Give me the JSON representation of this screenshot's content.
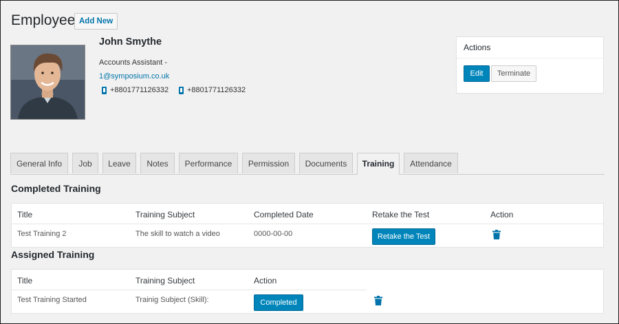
{
  "header": {
    "title": "Employee",
    "add_new_label": "Add New"
  },
  "employee": {
    "name": "John Smythe",
    "role": "Accounts Assistant -",
    "email": "1@symposium.co.uk",
    "phones": [
      "+8801771126332",
      "+8801771126332"
    ]
  },
  "actions": {
    "title": "Actions",
    "edit_label": "Edit",
    "terminate_label": "Terminate"
  },
  "tabs": [
    "General Info",
    "Job",
    "Leave",
    "Notes",
    "Performance",
    "Permission",
    "Documents",
    "Training",
    "Attendance"
  ],
  "active_tab": "Training",
  "completed_training": {
    "heading": "Completed Training",
    "columns": [
      "Title",
      "Training Subject",
      "Completed Date",
      "Retake the Test",
      "Action"
    ],
    "rows": [
      {
        "title": "Test Training 2",
        "subject": "The skill to watch a video",
        "date": "0000-00-00",
        "retake_label": "Retake the Test",
        "action_icon": "trash-icon"
      }
    ]
  },
  "assigned_training": {
    "heading": "Assigned Training",
    "columns": [
      "Title",
      "Training Subject",
      "Action"
    ],
    "rows": [
      {
        "title": "Test Training Started",
        "subject": "Trainig Subject (Skill):",
        "status_label": "Completed",
        "action_icon": "trash-icon"
      }
    ]
  },
  "colors": {
    "primary": "#0085ba",
    "link": "#0073aa",
    "background": "#f1f1f1"
  }
}
